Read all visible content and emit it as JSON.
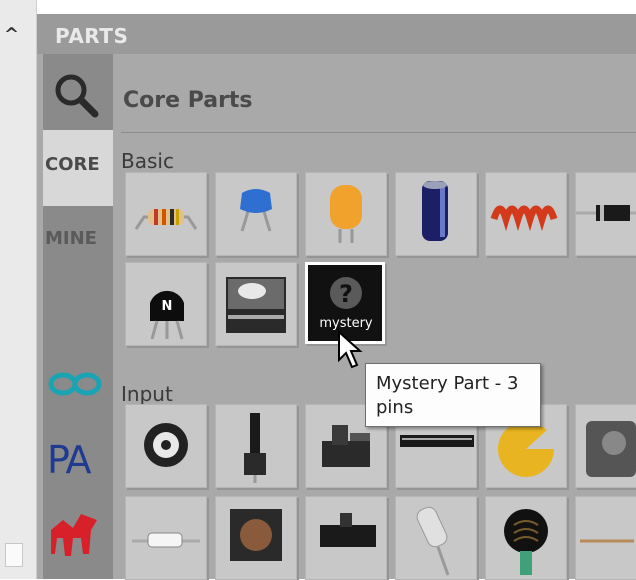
{
  "collapse_icon": "chevron-up-icon",
  "header": {
    "title": "PARTS"
  },
  "tabs": {
    "search_icon": "magnifier-icon",
    "core": "CORE",
    "mine": "MINE",
    "bin_icons": [
      "arduino-icon",
      "pa-icon",
      "fritzing-icon"
    ],
    "pa_text": "PA"
  },
  "main": {
    "title": "Core Parts"
  },
  "sections": {
    "basic": "Basic",
    "input": "Input"
  },
  "basic_parts": [
    "resistor-icon",
    "ceramic-capacitor-icon",
    "tantalum-capacitor-icon",
    "electrolytic-capacitor-icon",
    "inductor-icon",
    "diode-icon",
    "transistor-icon",
    "battery-icon",
    "mystery-part-icon"
  ],
  "input_parts": [
    "potentiometer-icon",
    "slide-potentiometer-icon",
    "rotary-encoder-icon",
    "pin-header-icon",
    "rotary-knob-icon",
    "trimmer-icon",
    "reed-switch-icon",
    "pushbutton-icon",
    "slide-switch-icon",
    "tilt-sensor-icon",
    "photocell-icon",
    "wire-icon"
  ],
  "transistor_label": "N",
  "mystery_part": {
    "symbol": "?",
    "label": "mystery"
  },
  "tooltip": {
    "text": "Mystery Part - 3 pins"
  },
  "colors": {
    "arduino": "#1aa3b2",
    "pa": "#1f3a93",
    "fritzing": "#d8202a"
  }
}
